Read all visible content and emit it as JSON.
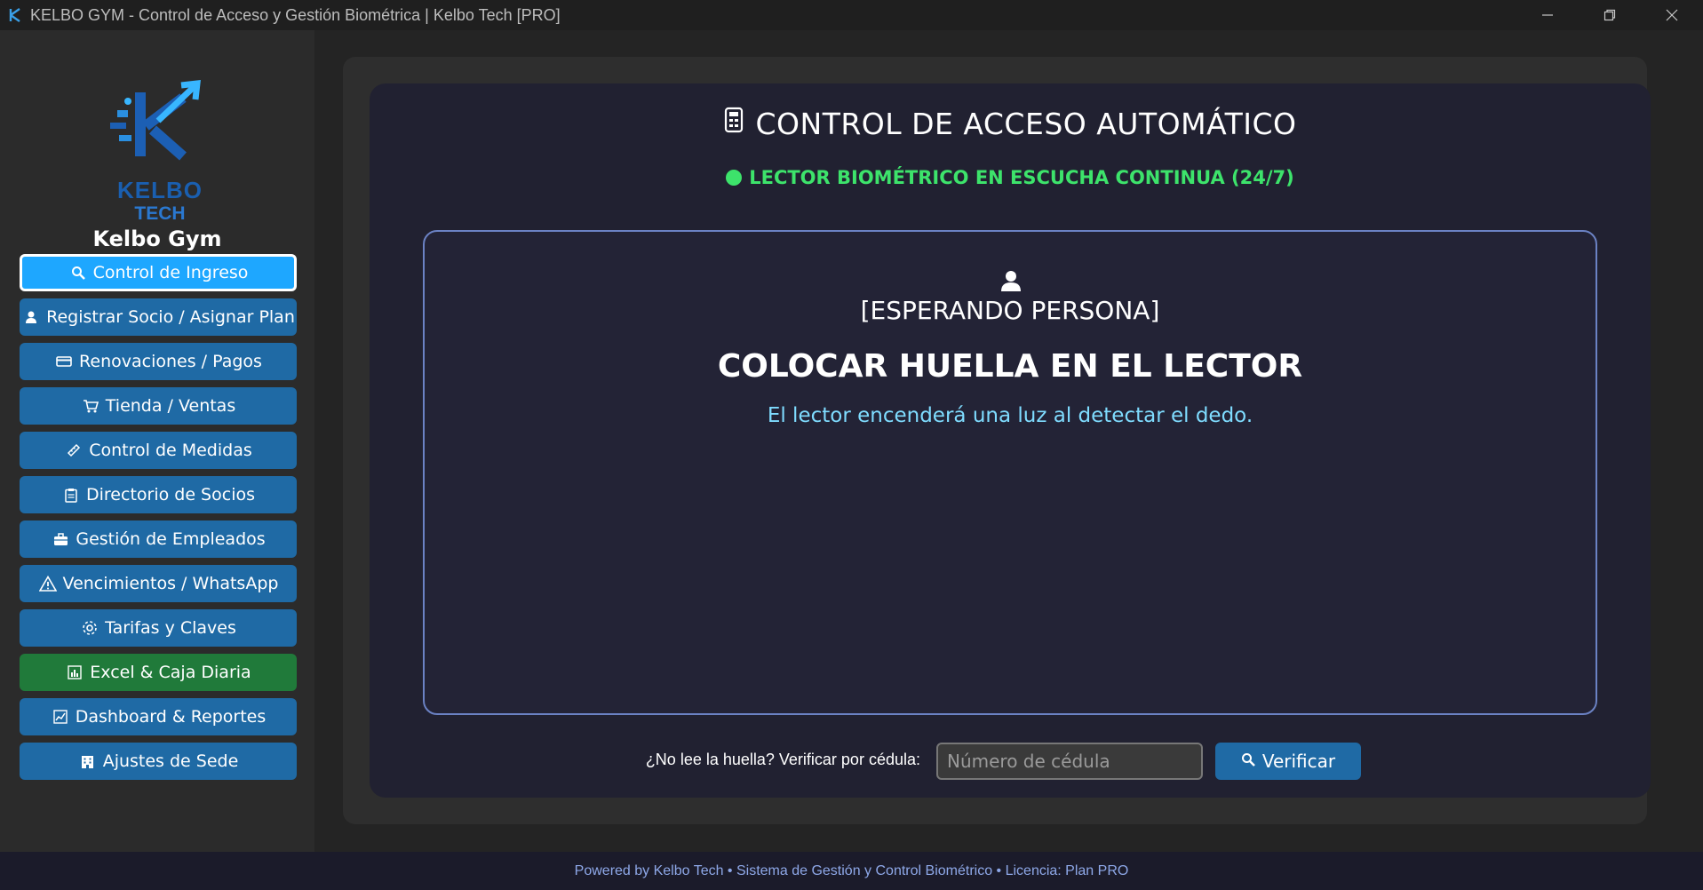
{
  "window": {
    "title": "KELBO GYM - Control de Acceso y Gestión Biométrica | Kelbo Tech [PRO]",
    "icon": "kelbo-logo-icon"
  },
  "sidebar": {
    "logo_line1": "KELBO",
    "logo_line2": "TECH",
    "gym_name": "Kelbo Gym",
    "items": [
      {
        "label": "Control de Ingreso",
        "icon": "search-icon",
        "state": "active"
      },
      {
        "label": "Registrar Socio / Asignar Plan",
        "icon": "user-icon"
      },
      {
        "label": "Renovaciones / Pagos",
        "icon": "credit-card-icon"
      },
      {
        "label": "Tienda / Ventas",
        "icon": "cart-icon"
      },
      {
        "label": "Control de Medidas",
        "icon": "ruler-icon"
      },
      {
        "label": "Directorio de Socios",
        "icon": "clipboard-icon"
      },
      {
        "label": "Gestión de Empleados",
        "icon": "briefcase-icon"
      },
      {
        "label": "Vencimientos / WhatsApp",
        "icon": "warning-icon"
      },
      {
        "label": "Tarifas y Claves",
        "icon": "gear-icon"
      },
      {
        "label": "Excel & Caja Diaria",
        "icon": "bar-chart-icon",
        "color": "#207a3a"
      },
      {
        "label": "Dashboard & Reportes",
        "icon": "line-chart-icon"
      },
      {
        "label": "Ajustes de Sede",
        "icon": "building-icon"
      }
    ]
  },
  "main": {
    "title": "CONTROL DE ACCESO AUTOMÁTICO",
    "status": "LECTOR BIOMÉTRICO EN ESCUCHA CONTINUA (24/7)",
    "reader": {
      "waiting": "[ESPERANDO PERSONA]",
      "instruction": "COLOCAR HUELLA EN EL LECTOR",
      "hint": "El lector encenderá una luz al detectar el dedo."
    },
    "manual": {
      "label": "¿No lee la huella? Verificar por cédula:",
      "placeholder": "Número de cédula",
      "value": "",
      "button": "Verificar"
    }
  },
  "footer": {
    "text": "Powered by Kelbo Tech  •  Sistema de Gestión y Control Biométrico  •  Licencia: Plan PRO"
  },
  "colors": {
    "accent": "#1f6aa5",
    "active": "#1ea7ff",
    "success": "#3de36b",
    "excel": "#207a3a",
    "hint": "#7fdcff"
  }
}
